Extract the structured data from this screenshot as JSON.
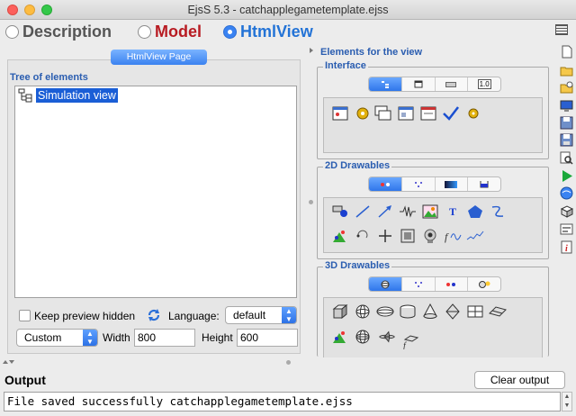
{
  "window": {
    "title": "EjsS 5.3 - catchapplegametemplate.ejss"
  },
  "modes": [
    {
      "label": "Description",
      "selected": false
    },
    {
      "label": "Model",
      "selected": false
    },
    {
      "label": "HtmlView",
      "selected": true
    }
  ],
  "left": {
    "page_tab": "HtmlView Page",
    "tree_label": "Tree of elements",
    "tree_root": "Simulation view",
    "keep_preview_label": "Keep preview hidden",
    "language_label": "Language:",
    "language_value": "default",
    "size_value": "Custom",
    "width_label": "Width",
    "width_value": "800",
    "height_label": "Height",
    "height_value": "600"
  },
  "right": {
    "title": "Elements for the view",
    "groups": [
      {
        "label": "Interface",
        "tab_4": "1.0"
      },
      {
        "label": "2D Drawables"
      },
      {
        "label": "3D Drawables"
      }
    ],
    "text_icon": "T"
  },
  "output": {
    "label": "Output",
    "clear_label": "Clear output",
    "message": "File saved successfully catchapplegametemplate.ejss"
  },
  "colors": {
    "accent": "#2a5db0",
    "model": "#b81b22",
    "htmlview": "#2373d6"
  }
}
